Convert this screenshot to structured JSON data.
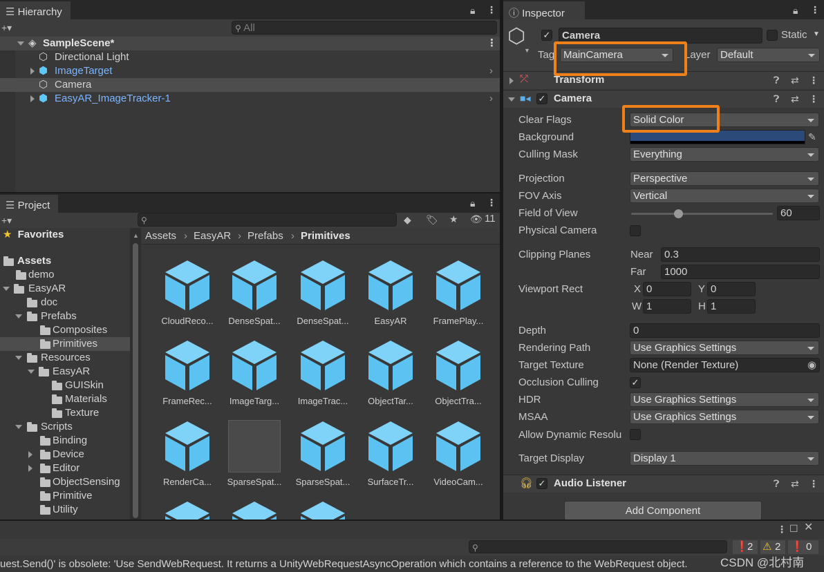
{
  "hierarchy": {
    "tab_label": "Hierarchy",
    "search_placeholder": "All",
    "scene_name": "SampleScene*",
    "items": [
      {
        "label": "Directional Light"
      },
      {
        "label": "ImageTarget"
      },
      {
        "label": "Camera"
      },
      {
        "label": "EasyAR_ImageTracker-1"
      }
    ]
  },
  "project": {
    "tab_label": "Project",
    "hidden_count": "11",
    "favorites_label": "Favorites",
    "tree": [
      {
        "label": "Assets"
      },
      {
        "label": "demo"
      },
      {
        "label": "EasyAR"
      },
      {
        "label": "doc"
      },
      {
        "label": "Prefabs"
      },
      {
        "label": "Composites"
      },
      {
        "label": "Primitives"
      },
      {
        "label": "Resources"
      },
      {
        "label": "EasyAR"
      },
      {
        "label": "GUISkin"
      },
      {
        "label": "Materials"
      },
      {
        "label": "Texture"
      },
      {
        "label": "Scripts"
      },
      {
        "label": "Binding"
      },
      {
        "label": "Device"
      },
      {
        "label": "Editor"
      },
      {
        "label": "ObjectSensing"
      },
      {
        "label": "Primitive"
      },
      {
        "label": "Utility"
      }
    ],
    "breadcrumb": [
      "Assets",
      "EasyAR",
      "Prefabs",
      "Primitives"
    ],
    "assets": [
      {
        "label": "CloudReco..."
      },
      {
        "label": "DenseSpat..."
      },
      {
        "label": "DenseSpat..."
      },
      {
        "label": "EasyAR"
      },
      {
        "label": "FramePlay..."
      },
      {
        "label": "FrameRec..."
      },
      {
        "label": "ImageTarg..."
      },
      {
        "label": "ImageTrac..."
      },
      {
        "label": "ObjectTar..."
      },
      {
        "label": "ObjectTra..."
      },
      {
        "label": "RenderCa..."
      },
      {
        "label": "SparseSpat..."
      },
      {
        "label": "SparseSpat..."
      },
      {
        "label": "SurfaceTr..."
      },
      {
        "label": "VideoCam..."
      }
    ]
  },
  "inspector": {
    "tab_label": "Inspector",
    "object_name": "Camera",
    "static_label": "Static",
    "tag_label": "Tag",
    "tag_value": "MainCamera",
    "layer_label": "Layer",
    "layer_value": "Default",
    "transform_label": "Transform",
    "camera_label": "Camera",
    "audio_listener_label": "Audio Listener",
    "add_component_label": "Add Component",
    "background_color": "#2b4a7a",
    "highlight_color": "#f0801a",
    "props": {
      "clear_flags": {
        "label": "Clear Flags",
        "value": "Solid Color"
      },
      "background": {
        "label": "Background"
      },
      "culling_mask": {
        "label": "Culling Mask",
        "value": "Everything"
      },
      "projection": {
        "label": "Projection",
        "value": "Perspective"
      },
      "fov_axis": {
        "label": "FOV Axis",
        "value": "Vertical"
      },
      "field_of_view": {
        "label": "Field of View",
        "value": "60"
      },
      "physical_camera": {
        "label": "Physical Camera"
      },
      "clipping_planes": {
        "label": "Clipping Planes",
        "near_label": "Near",
        "near": "0.3",
        "far_label": "Far",
        "far": "1000"
      },
      "viewport_rect": {
        "label": "Viewport Rect",
        "x_label": "X",
        "x": "0",
        "y_label": "Y",
        "y": "0",
        "w_label": "W",
        "w": "1",
        "h_label": "H",
        "h": "1"
      },
      "depth": {
        "label": "Depth",
        "value": "0"
      },
      "rendering_path": {
        "label": "Rendering Path",
        "value": "Use Graphics Settings"
      },
      "target_texture": {
        "label": "Target Texture",
        "value": "None (Render Texture)"
      },
      "occlusion_culling": {
        "label": "Occlusion Culling"
      },
      "hdr": {
        "label": "HDR",
        "value": "Use Graphics Settings"
      },
      "msaa": {
        "label": "MSAA",
        "value": "Use Graphics Settings"
      },
      "allow_dynamic": {
        "label": "Allow Dynamic Resolu"
      },
      "target_display": {
        "label": "Target Display",
        "value": "Display 1"
      }
    }
  },
  "console": {
    "message": "uest.Send()' is obsolete: 'Use SendWebRequest.  It returns a UnityWebRequestAsyncOperation which contains a reference to the WebRequest object.",
    "info_count": "2",
    "warn_count": "2",
    "error_count": "0",
    "watermark": "CSDN @北村南"
  }
}
